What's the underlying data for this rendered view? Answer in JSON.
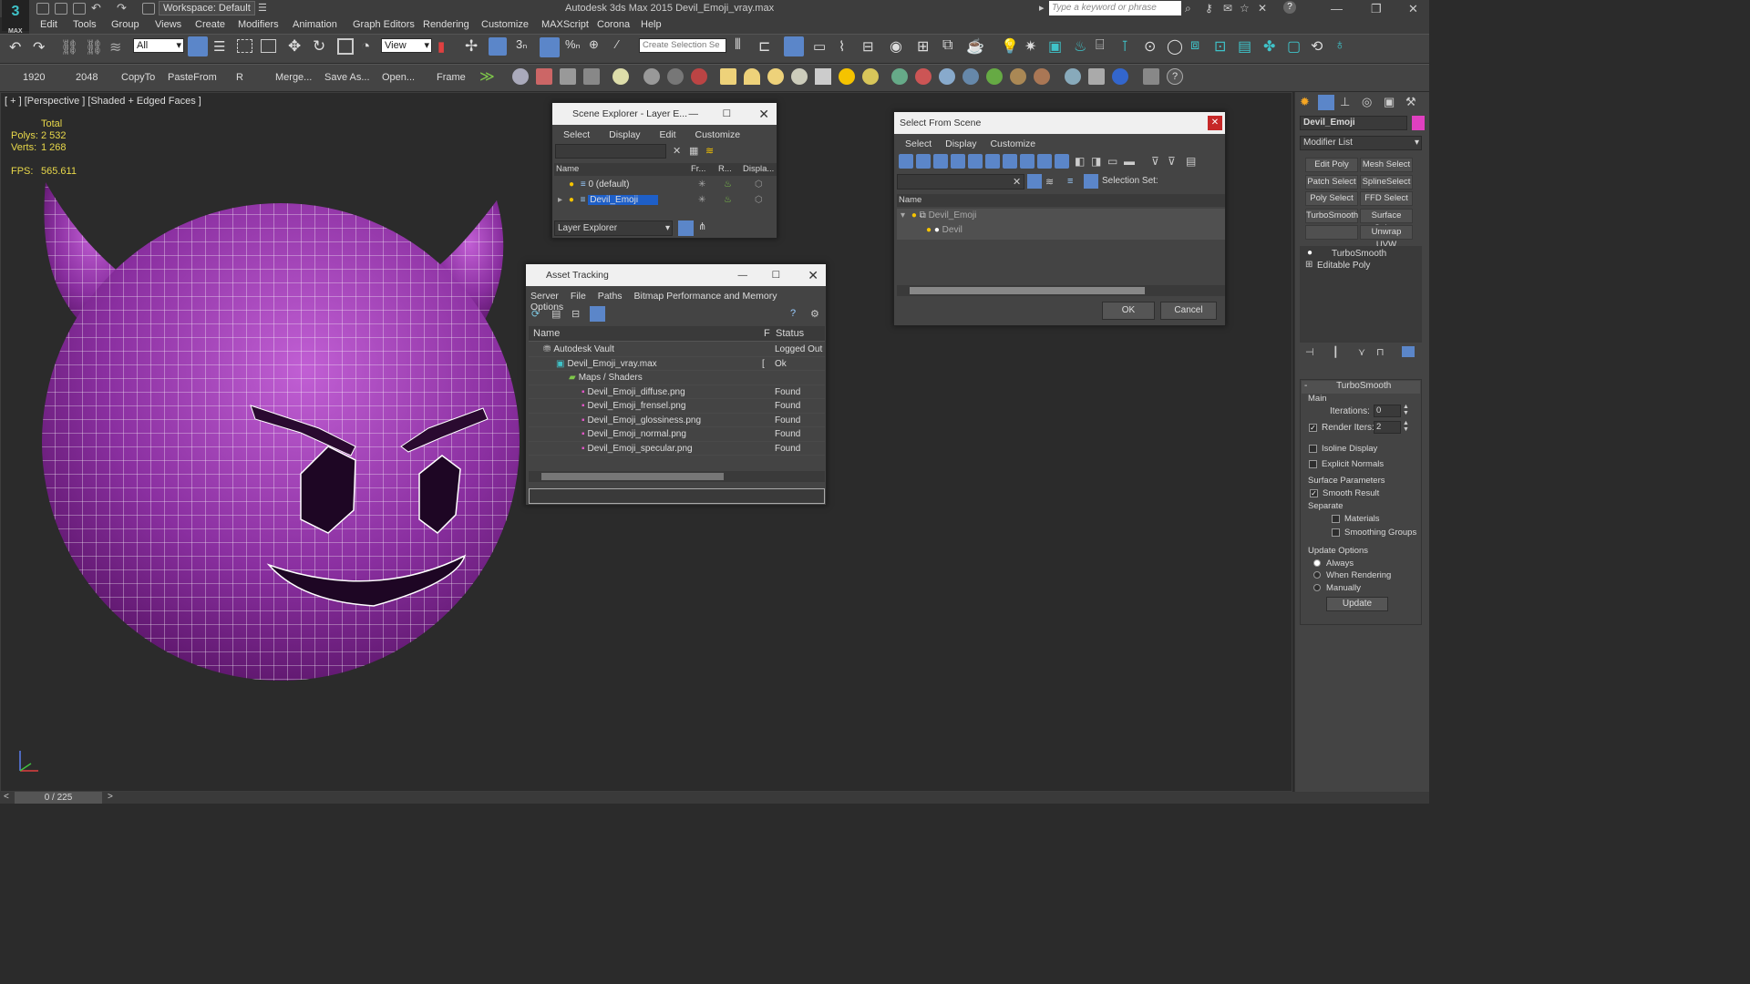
{
  "titlebar": {
    "logo_text": "MAX",
    "workspace": "Workspace: Default",
    "app_title": "Autodesk 3ds Max  2015    Devil_Emoji_vray.max",
    "search_placeholder": "Type a keyword or phrase"
  },
  "menu": [
    "Edit",
    "Tools",
    "Group",
    "Views",
    "Create",
    "Modifiers",
    "Animation",
    "Graph Editors",
    "Rendering",
    "Customize",
    "MAXScript",
    "Corona",
    "Help"
  ],
  "toolbar1": {
    "filter": "All",
    "view": "View",
    "selection_set": "Create Selection Se"
  },
  "toolbar2": {
    "labels": [
      "1920",
      "2048",
      "CopyTo",
      "PasteFrom",
      "R",
      "Merge...",
      "Save As...",
      "Open...",
      "Frame"
    ]
  },
  "viewport": {
    "label": "[ + ] [Perspective ] [Shaded + Edged Faces ]",
    "total": "Total",
    "polys_label": "Polys:",
    "polys": "2 532",
    "verts_label": "Verts:",
    "verts": "1 268",
    "fps_label": "FPS:",
    "fps": "565.611"
  },
  "scene_explorer": {
    "title": "Scene Explorer - Layer E...",
    "menu": [
      "Select",
      "Display",
      "Edit",
      "Customize"
    ],
    "columns": [
      "Name",
      "Fr...",
      "R...",
      "Displa..."
    ],
    "rows": [
      "0 (default)",
      "Devil_Emoji"
    ],
    "footer": "Layer Explorer"
  },
  "asset_tracking": {
    "title": "Asset Tracking",
    "menu": [
      "Server",
      "File",
      "Paths",
      "Bitmap Performance and Memory",
      "Options"
    ],
    "columns": [
      "Name",
      "F",
      "Status"
    ],
    "rows": [
      {
        "name": "Autodesk Vault",
        "f": "",
        "status": "Logged Out"
      },
      {
        "name": "Devil_Emoji_vray.max",
        "f": "[",
        "status": "Ok"
      },
      {
        "name": "Maps / Shaders",
        "f": "",
        "status": ""
      },
      {
        "name": "Devil_Emoji_diffuse.png",
        "f": "",
        "status": "Found"
      },
      {
        "name": "Devil_Emoji_frensel.png",
        "f": "",
        "status": "Found"
      },
      {
        "name": "Devil_Emoji_glossiness.png",
        "f": "",
        "status": "Found"
      },
      {
        "name": "Devil_Emoji_normal.png",
        "f": "",
        "status": "Found"
      },
      {
        "name": "Devil_Emoji_specular.png",
        "f": "",
        "status": "Found"
      }
    ]
  },
  "select_from_scene": {
    "title": "Select From Scene",
    "menu": [
      "Select",
      "Display",
      "Customize"
    ],
    "selection_set_label": "Selection Set:",
    "column": "Name",
    "tree": [
      "Devil_Emoji",
      "Devil"
    ],
    "ok": "OK",
    "cancel": "Cancel"
  },
  "command_panel": {
    "object_name": "Devil_Emoji",
    "object_color": "#e040c0",
    "modifier_list": "Modifier List",
    "buttons": [
      "Edit Poly",
      "Mesh Select",
      "Patch Select",
      "SplineSelect",
      "Poly Select",
      "FFD Select",
      "TurboSmooth",
      "Surface Select",
      "",
      "Unwrap UVW"
    ],
    "stack": [
      "TurboSmooth",
      "Editable Poly"
    ],
    "rollout_title": "TurboSmooth",
    "main_label": "Main",
    "iterations_label": "Iterations:",
    "iterations": "0",
    "render_iters_label": "Render Iters:",
    "render_iters": "2",
    "isoline": "Isoline Display",
    "explicit_normals": "Explicit Normals",
    "surface_params": "Surface Parameters",
    "smooth_result": "Smooth Result",
    "separate": "Separate",
    "materials": "Materials",
    "smoothing_groups": "Smoothing Groups",
    "update_options": "Update Options",
    "always": "Always",
    "when_rendering": "When Rendering",
    "manually": "Manually",
    "update": "Update"
  },
  "statusbar": {
    "frame": "0 / 225"
  },
  "colors": {
    "mesh": "#8a2fa0",
    "wire": "#ffffff",
    "stats": "#e8d84a",
    "selection": "#1e5fc8"
  }
}
